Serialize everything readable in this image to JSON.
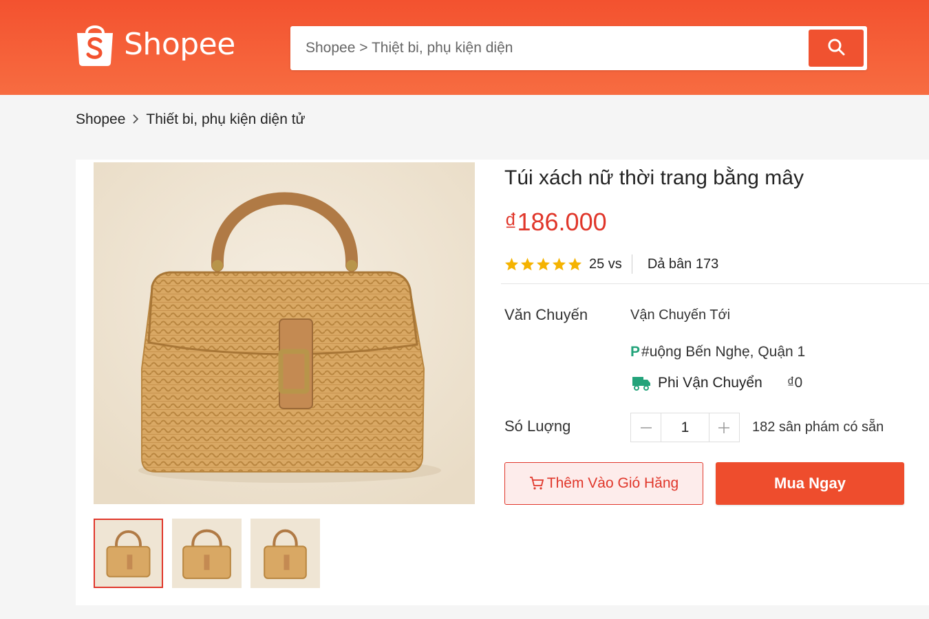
{
  "header": {
    "logo_text": "Shopee",
    "search_placeholder": "Shopee > Thiệt bi, phụ kiện diện"
  },
  "breadcrumb": {
    "items": [
      "Shopee",
      "Thiết bi, phụ kiện diện tử"
    ],
    "separator": ">"
  },
  "product": {
    "title": "Túi xách nữ thời trang bằng mây",
    "price": "₫186.000",
    "rating_stars": 5,
    "review_count": "25 vs",
    "sold": "Dả bân 173",
    "shipping_label": "Văn Chuyến",
    "ship_to": "Vận Chuyến Tới",
    "ship_addr_icon": "P",
    "ship_addr": "#uộng Bến Nghẹ, Quận 1",
    "ship_fee_label": "Phi Vận Chuyển",
    "ship_fee_value": "₫0",
    "quantity_label": "Só Luợng",
    "quantity": "1",
    "stock": "182 sân phám có sẵn",
    "add_to_cart": "Thêm Vào Gió Hăng",
    "buy_now": "Mua Ngay"
  },
  "colors": {
    "brand": "#ee4d2d",
    "price": "#e0362a",
    "star": "#f5b301",
    "ship_icon": "#23a37a"
  },
  "icons": [
    "shopee-bag-icon",
    "search-icon",
    "star-icon",
    "truck-icon",
    "cart-icon",
    "minus-icon",
    "plus-icon"
  ]
}
